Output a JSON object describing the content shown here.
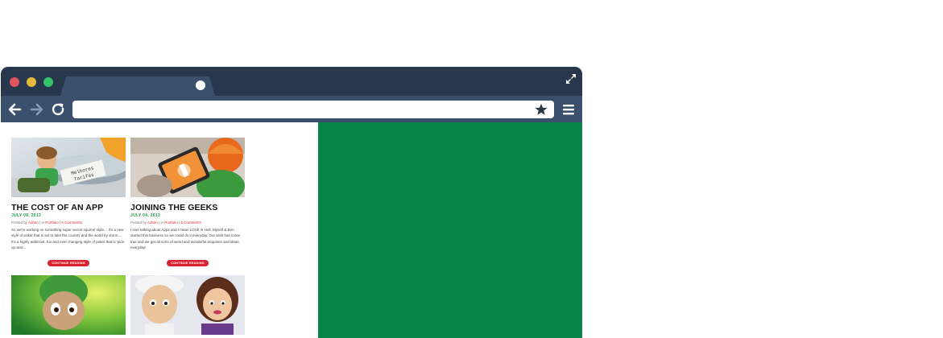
{
  "browser": {
    "window_controls": [
      "close",
      "minimize",
      "maximize"
    ],
    "colors": {
      "titlebar": "#27384d",
      "toolbar": "#3a4f6b",
      "panel": "#058446",
      "accent": "#d9222f",
      "date": "#1ea24a"
    },
    "url": ""
  },
  "posts": [
    {
      "title": "THE COST OF AN APP",
      "date": "JULY 08, 2013",
      "meta_prefix": "Posted by ",
      "author": "Admin",
      "meta_sep1": " | in ",
      "category": "Portfolio",
      "meta_sep2": " | ",
      "comments": "5 Comments",
      "excerpt": "So we're working on something super secret squirrel style… It's a new style of poker that is set to take the country and the world by storm… It's a highly addictive, fun and ever changing style of poker that is 'pick-up-and…",
      "button": "CONTINUE READING",
      "image_text": "Melhores Tarifas"
    },
    {
      "title": "JOINING THE GEEKS",
      "date": "JULY 04, 2013",
      "meta_prefix": "Posted by ",
      "author": "Admin",
      "meta_sep1": " | in ",
      "category": "Portfolio",
      "meta_sep2": " | ",
      "comments": "5 Comments",
      "excerpt": "I love talking about Apps and I mean LOVE it! Hell, Myself & Ben started this business so we could do it everyday. Our wish has come true and we get all sorts of weird and wonderful enquiries and ideas everyday!",
      "button": "CONTINUE READING"
    }
  ]
}
